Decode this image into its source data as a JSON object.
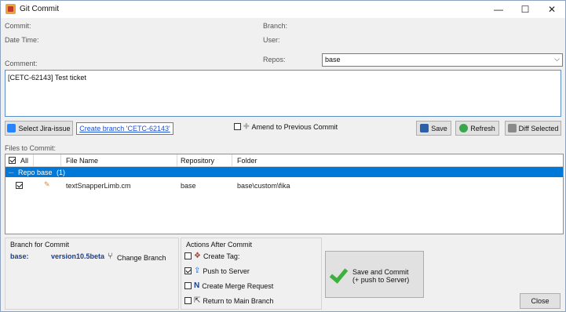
{
  "window": {
    "title": "Git Commit",
    "minimize": "—",
    "maximize": "☐",
    "close": "✕"
  },
  "labels": {
    "commit": "Commit:",
    "branch": "Branch:",
    "datetime": "Date Time:",
    "user": "User:",
    "comment": "Comment:",
    "repos": "Repos:",
    "files_to_commit": "Files to Commit:"
  },
  "repos_combo": {
    "value": "base"
  },
  "comment_text": "[CETC-62143] Test ticket",
  "toolbar": {
    "select_jira": "Select Jira-issue",
    "create_branch": "Create branch 'CETC-62143'",
    "amend": "Amend to Previous Commit",
    "save": "Save",
    "refresh": "Refresh",
    "diff_selected": "Diff Selected"
  },
  "grid": {
    "headers": {
      "all": "All",
      "file_name": "File Name",
      "repository": "Repository",
      "folder": "Folder"
    },
    "group": {
      "label": "Repo",
      "name": "base",
      "count": "(1)"
    },
    "rows": [
      {
        "file": "textSnapperLimb.cm",
        "repository": "base",
        "folder": "base\\custom\\fika",
        "checked": true
      }
    ]
  },
  "branch_panel": {
    "title": "Branch for Commit",
    "repo": "base:",
    "branch": "version10.5beta",
    "change": "Change Branch"
  },
  "actions_panel": {
    "title": "Actions After Commit",
    "items": [
      {
        "label": "Create Tag:",
        "checked": false
      },
      {
        "label": "Push to Server",
        "checked": true
      },
      {
        "label": "Create Merge Request",
        "checked": false
      },
      {
        "label": "Return to Main Branch",
        "checked": false
      }
    ]
  },
  "commit_button": {
    "line1": "Save and Commit",
    "line2": "(+ push to Server)"
  },
  "close_button": "Close",
  "colors": {
    "selection": "#0078d7",
    "link": "#1a4fd6",
    "branch_text": "#1a3e8c"
  }
}
